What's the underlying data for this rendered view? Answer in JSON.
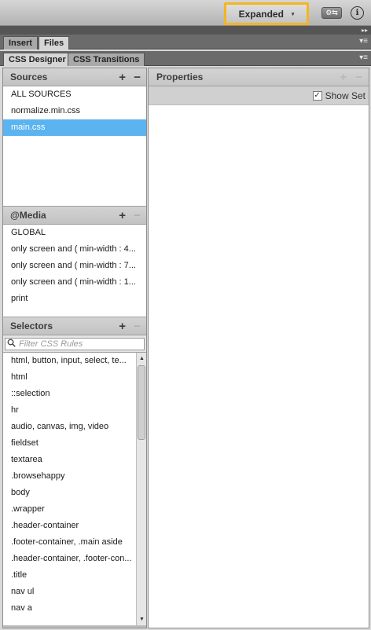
{
  "topbar": {
    "workspace_label": "Expanded",
    "workspace_caret": "▾",
    "sync_glyph": "⚙⇆",
    "info_glyph": "i"
  },
  "collapse_glyph": "▸▸",
  "panel_tabs": [
    {
      "label": "Insert",
      "active": false
    },
    {
      "label": "Files",
      "active": true
    }
  ],
  "designer_tabs": [
    {
      "label": "CSS Designer",
      "active": true
    },
    {
      "label": "CSS Transitions",
      "active": false
    }
  ],
  "menu_glyph": "▾≡",
  "sources": {
    "title": "Sources",
    "add_glyph": "+",
    "remove_glyph": "−",
    "items": [
      "ALL SOURCES",
      "normalize.min.css",
      "main.css"
    ],
    "selected_index": 2
  },
  "media": {
    "title": "@Media",
    "add_glyph": "+",
    "remove_glyph": "−",
    "items": [
      "GLOBAL",
      "only screen and ( min-width : 4...",
      "only screen and ( min-width : 7...",
      "only screen and ( min-width : 1...",
      "print"
    ]
  },
  "selectors": {
    "title": "Selectors",
    "add_glyph": "+",
    "remove_glyph": "−",
    "filter_placeholder": "Filter CSS Rules",
    "items": [
      "html, button, input, select, te...",
      "html",
      "::selection",
      "hr",
      "audio, canvas, img, video",
      "fieldset",
      "textarea",
      ".browsehappy",
      "body",
      ".wrapper",
      ".header-container",
      ".footer-container, .main aside",
      ".header-container, .footer-con...",
      ".title",
      "nav ul",
      "nav a"
    ]
  },
  "properties": {
    "title": "Properties",
    "add_glyph": "+",
    "remove_glyph": "−",
    "show_set_label": "Show Set",
    "show_set_checked": true,
    "check_glyph": "✓"
  },
  "scroll": {
    "up_glyph": "▲",
    "down_glyph": "▼"
  }
}
